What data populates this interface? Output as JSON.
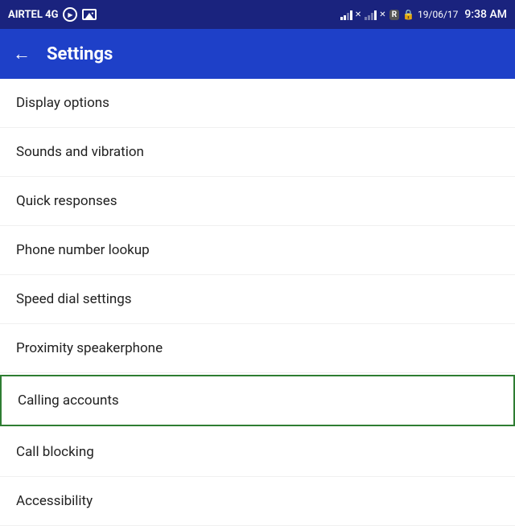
{
  "statusBar": {
    "carrier": "AIRTEL 4G",
    "date": "19/06/17",
    "time": "9:38 AM",
    "roaming": "R"
  },
  "appBar": {
    "title": "Settings",
    "backLabel": "←"
  },
  "settingsItems": [
    {
      "id": "display-options",
      "label": "Display options",
      "highlighted": false
    },
    {
      "id": "sounds-vibration",
      "label": "Sounds and vibration",
      "highlighted": false
    },
    {
      "id": "quick-responses",
      "label": "Quick responses",
      "highlighted": false
    },
    {
      "id": "phone-number-lookup",
      "label": "Phone number lookup",
      "highlighted": false
    },
    {
      "id": "speed-dial-settings",
      "label": "Speed dial settings",
      "highlighted": false
    },
    {
      "id": "proximity-speakerphone",
      "label": "Proximity speakerphone",
      "highlighted": false
    },
    {
      "id": "calling-accounts",
      "label": "Calling accounts",
      "highlighted": true
    },
    {
      "id": "call-blocking",
      "label": "Call blocking",
      "highlighted": false
    },
    {
      "id": "accessibility",
      "label": "Accessibility",
      "highlighted": false
    }
  ]
}
